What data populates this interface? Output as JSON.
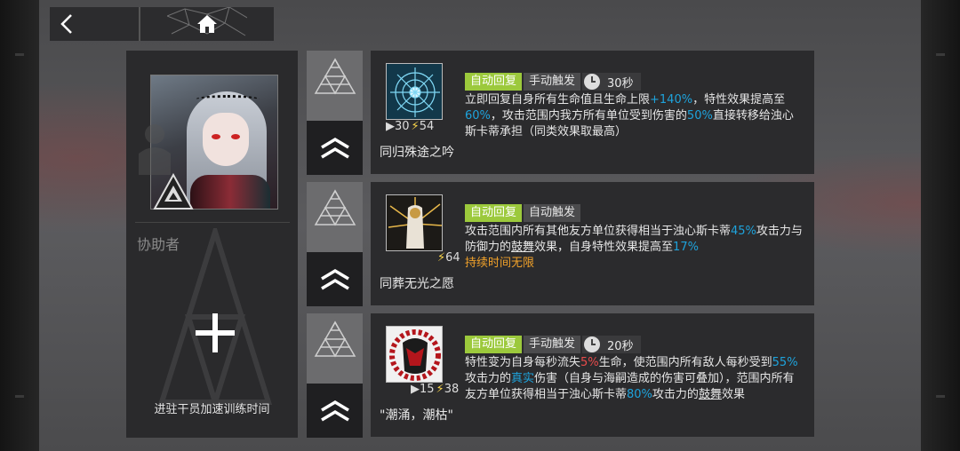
{
  "nav": {
    "back_icon": "chevron-left-icon",
    "home_icon": "home-icon"
  },
  "assist": {
    "title": "协助者",
    "footer": "进驻干员加速训练时间"
  },
  "skills": [
    {
      "name": "同归殊途之吟",
      "icon": "skill-rune-icon",
      "initial_sp": "30",
      "sp_cost": "54",
      "tags": [
        "自动回复",
        "手动触发"
      ],
      "duration": "30秒",
      "desc": {
        "a": "立即回复自身所有生命值且生命上限",
        "b": "+140%",
        "c": "，特性效果提高至",
        "d": "60%",
        "e": "，攻击范围内我方所有单位受到伤害的",
        "f": "50%",
        "g": "直接转移给浊心斯卡蒂承担（同类效果取最高）"
      }
    },
    {
      "name": "同葬无光之愿",
      "icon": "skill-figure-icon",
      "sp_cost": "64",
      "tags": [
        "自动回复",
        "自动触发"
      ],
      "desc": {
        "a": "攻击范围内所有其他友方单位获得相当于浊心斯卡蒂",
        "b": "45%",
        "c": "攻击力与防御力的",
        "d": "鼓舞",
        "e": "效果，自身特性效果提高至",
        "f": "17%",
        "g": "持续时间无限"
      }
    },
    {
      "name": "\"潮涌，潮枯\"",
      "icon": "skill-mask-icon",
      "initial_sp": "15",
      "sp_cost": "38",
      "tags": [
        "自动回复",
        "手动触发"
      ],
      "duration": "20秒",
      "desc": {
        "a": "特性变为自身每秒流失",
        "b": "5%",
        "c": "生命，使范围内所有敌人每秒受到",
        "d": "55%",
        "e": "攻击力的",
        "f": "真实",
        "g": "伤害（自身与海嗣造成的伤害可叠加），范围内所有友方单位获得相当于浊心斯卡蒂",
        "h": "80%",
        "i": "攻击力的",
        "j": "鼓舞",
        "k": "效果"
      }
    }
  ],
  "colors": {
    "accent_green": "#9cc93c",
    "highlight_blue": "#1ea3dc",
    "highlight_red": "#e84b4b",
    "highlight_orange": "#f0a12a"
  }
}
